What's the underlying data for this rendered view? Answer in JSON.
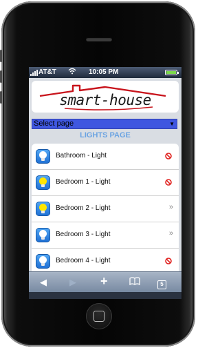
{
  "statusbar": {
    "carrier": "AT&T",
    "time": "10:05 PM"
  },
  "app": {
    "logo_text": "smart-house",
    "select": {
      "value": "Select page"
    },
    "page_title": "LIGHTS PAGE",
    "lights": [
      {
        "label": "Bathroom - Light",
        "bulb_color": "#ffffff",
        "action_icon": "no-entry-icon"
      },
      {
        "label": "Bedroom 1 - Light",
        "bulb_color": "#ffe600",
        "action_icon": "no-entry-icon"
      },
      {
        "label": "Bedroom 2 - Light",
        "bulb_color": "#ffe600",
        "action_icon": "chevron-double-right-icon"
      },
      {
        "label": "Bedroom 3 - Light",
        "bulb_color": "#ffffff",
        "action_icon": "chevron-double-right-icon"
      },
      {
        "label": "Bedroom 4 - Light",
        "bulb_color": "#ffffff",
        "action_icon": "no-entry-icon"
      }
    ]
  },
  "toolbar": {
    "tab_count": "5",
    "icons": [
      "back-icon",
      "forward-icon",
      "add-icon",
      "bookmarks-icon",
      "tabs-icon"
    ]
  },
  "colors": {
    "statusbar": "#1f2a3b",
    "select_bg": "#3f57e0",
    "page_title": "#6aa3e2",
    "toolbar": "#7789a1",
    "logo_red": "#c8141c"
  }
}
